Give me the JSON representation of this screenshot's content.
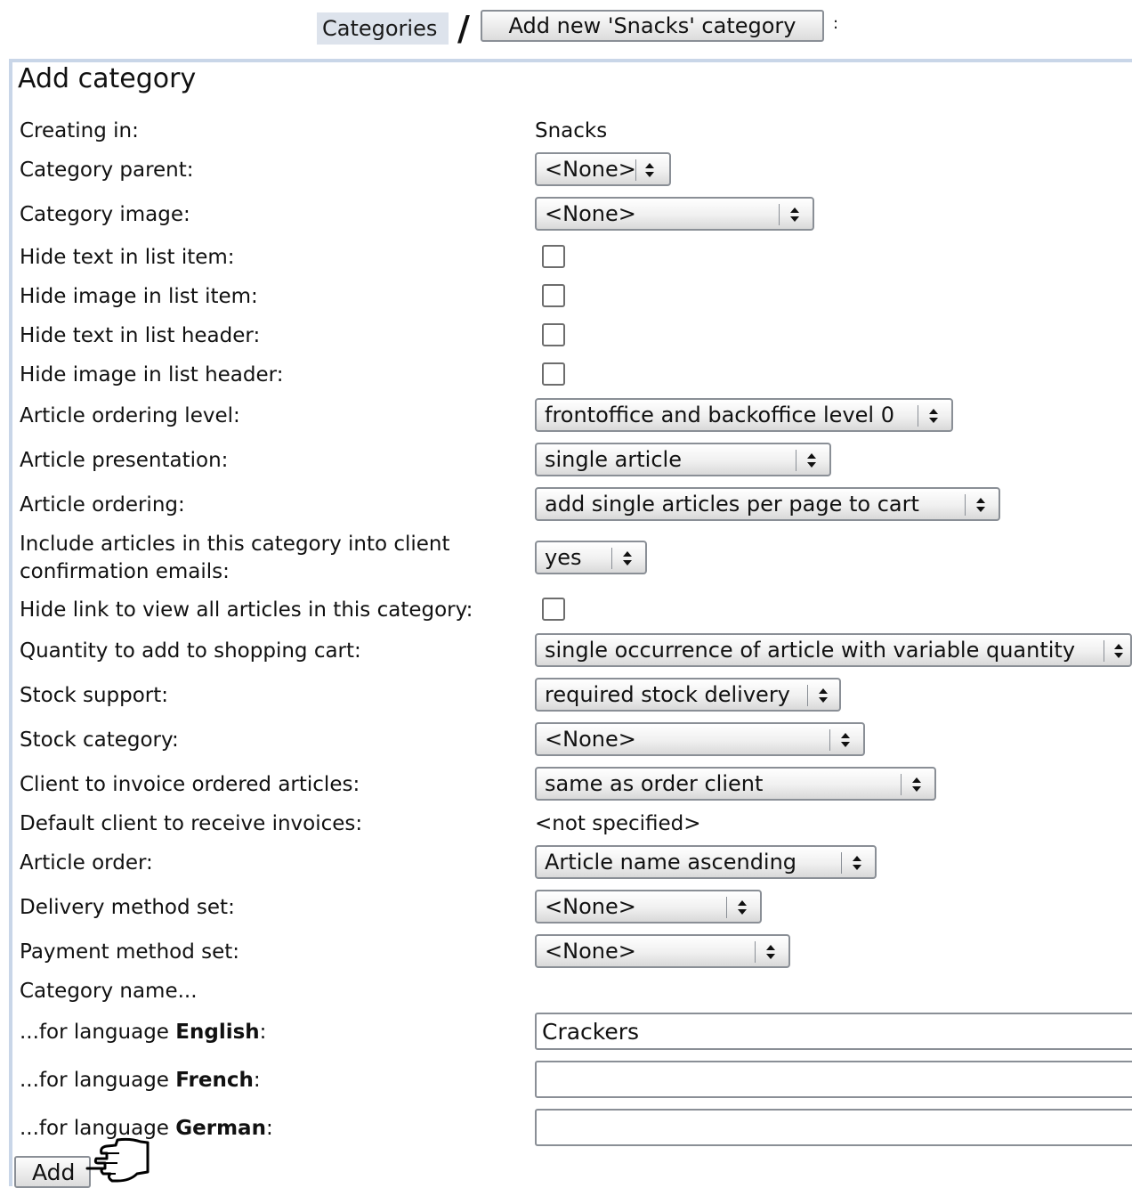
{
  "breadcrumb": {
    "link": "Categories",
    "separator": "/",
    "button": "Add new 'Snacks' category",
    "trailing": ":"
  },
  "title": "Add category",
  "fields": {
    "creating_in": {
      "label": "Creating in:",
      "value": "Snacks"
    },
    "category_parent": {
      "label": "Category parent:",
      "value": "<None>"
    },
    "category_image": {
      "label": "Category image:",
      "value": "<None>"
    },
    "hide_text_list_item": {
      "label": "Hide text in list item:",
      "checked": false
    },
    "hide_image_list_item": {
      "label": "Hide image in list item:",
      "checked": false
    },
    "hide_text_list_header": {
      "label": "Hide text in list header:",
      "checked": false
    },
    "hide_image_list_header": {
      "label": "Hide image in list header:",
      "checked": false
    },
    "article_ordering_level": {
      "label": "Article ordering level:",
      "value": "frontoffice and backoffice level 0"
    },
    "article_presentation": {
      "label": "Article presentation:",
      "value": "single article"
    },
    "article_ordering": {
      "label": "Article ordering:",
      "value": "add single articles per page to cart"
    },
    "include_in_emails": {
      "label_line1": "Include articles in this category into client",
      "label_line2": "confirmation emails:",
      "value": "yes"
    },
    "hide_view_all_link": {
      "label": "Hide link to view all articles in this category:",
      "checked": false
    },
    "quantity_to_add": {
      "label": "Quantity to add to shopping cart:",
      "value": "single occurrence of article with variable quantity"
    },
    "stock_support": {
      "label": "Stock support:",
      "value": "required stock delivery"
    },
    "stock_category": {
      "label": "Stock category:",
      "value": "<None>"
    },
    "client_to_invoice": {
      "label": "Client to invoice ordered articles:",
      "value": "same as order client"
    },
    "default_invoice_client": {
      "label": "Default client to receive invoices:",
      "value": "<not specified>"
    },
    "article_order": {
      "label": "Article order:",
      "value": "Article name ascending"
    },
    "delivery_method_set": {
      "label": "Delivery method set:",
      "value": "<None>"
    },
    "payment_method_set": {
      "label": "Payment method set:",
      "value": "<None>"
    }
  },
  "category_name": {
    "heading": "Category name...",
    "prefix": "...for language ",
    "suffix": ":",
    "english": {
      "language": "English",
      "value": "Crackers"
    },
    "french": {
      "language": "French",
      "value": ""
    },
    "german": {
      "language": "German",
      "value": ""
    }
  },
  "add_button": "Add"
}
